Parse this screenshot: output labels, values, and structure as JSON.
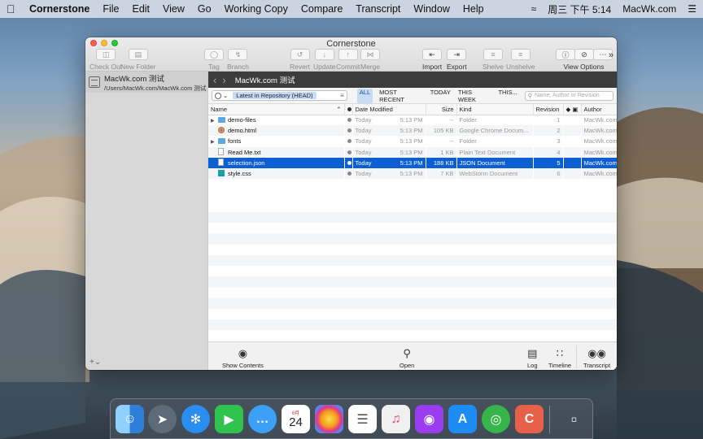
{
  "menubar": {
    "app_name": "Cornerstone",
    "items": [
      "File",
      "Edit",
      "View",
      "Go",
      "Working Copy",
      "Compare",
      "Transcript",
      "Window",
      "Help"
    ],
    "datetime": "周三 下午 5:14",
    "user": "MacWk.com"
  },
  "window": {
    "title": "Cornerstone",
    "toolbar": {
      "check_out": "Check Out",
      "new_folder": "New Folder",
      "tag": "Tag",
      "branch": "Branch",
      "revert": "Revert",
      "update": "Update",
      "commit": "Commit",
      "merge": "Merge",
      "import": "Import",
      "export": "Export",
      "shelve": "Shelve",
      "unshelve": "Unshelve",
      "view_options": "View Options"
    }
  },
  "sidebar": {
    "repo_name": "MacWk.com 测试",
    "repo_path": "/Users/MacWk.com/MacWk.com 测试",
    "add_button": "+⌄"
  },
  "pathbar": {
    "back": "‹",
    "forward": "›",
    "crumb": "MacWk.com 测试"
  },
  "filterbar": {
    "scope": "Latest in Repository (HEAD)",
    "filters": [
      "ALL",
      "MOST RECENT",
      "TODAY",
      "THIS WEEK",
      "THIS..."
    ],
    "search_placeholder": "Name, Author or Revision"
  },
  "table": {
    "columns": {
      "name": "Name",
      "date": "Date Modified",
      "size": "Size",
      "kind": "Kind",
      "revision": "Revision",
      "author": "Author"
    },
    "rows": [
      {
        "name": "demo-files",
        "day": "Today",
        "time": "5:13 PM",
        "size": "--",
        "kind": "Folder",
        "revision": "1",
        "author": "MacWk.com",
        "icon": "folder",
        "expandable": true
      },
      {
        "name": "demo.html",
        "day": "Today",
        "time": "5:13 PM",
        "size": "105 KB",
        "kind": "Google Chrome Docum...",
        "revision": "2",
        "author": "MacWk.com",
        "icon": "chrome",
        "expandable": false
      },
      {
        "name": "fonts",
        "day": "Today",
        "time": "5:13 PM",
        "size": "--",
        "kind": "Folder",
        "revision": "3",
        "author": "MacWk.com",
        "icon": "folder",
        "expandable": true
      },
      {
        "name": "Read Me.txt",
        "day": "Today",
        "time": "5:13 PM",
        "size": "1 KB",
        "kind": "Plain Text Document",
        "revision": "4",
        "author": "MacWk.com",
        "icon": "doc",
        "expandable": false
      },
      {
        "name": "selection.json",
        "day": "Today",
        "time": "5:13 PM",
        "size": "188 KB",
        "kind": "JSON Document",
        "revision": "5",
        "author": "MacWk.com",
        "icon": "doc",
        "expandable": false,
        "selected": true
      },
      {
        "name": "style.css",
        "day": "Today",
        "time": "5:13 PM",
        "size": "7 KB",
        "kind": "WebStorm Document",
        "revision": "6",
        "author": "MacWk.com",
        "icon": "webstorm",
        "expandable": false
      }
    ]
  },
  "bottombar": {
    "show_contents": "Show Contents",
    "open": "Open",
    "log": "Log",
    "timeline": "Timeline",
    "transcript": "Transcript"
  },
  "dock": {
    "calendar_month": "6月",
    "calendar_day": "24"
  },
  "colors": {
    "selection": "#0b5fd3",
    "filter_active_bg": "#c7dbf4",
    "pathbar_bg": "#3c3c3c"
  }
}
